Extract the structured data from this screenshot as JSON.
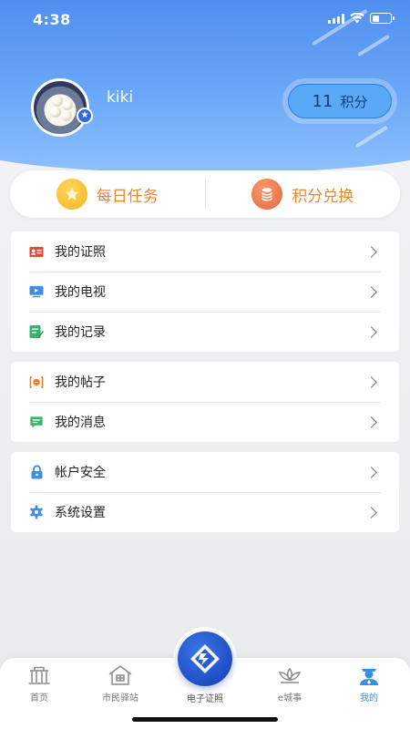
{
  "status_bar": {
    "time": "4:38"
  },
  "profile": {
    "username": "kiki",
    "points_value": "11",
    "points_unit": "积分"
  },
  "quick_actions": {
    "daily_tasks": "每日任务",
    "points_exchange": "积分兑换"
  },
  "menu": {
    "group1": [
      {
        "label": "我的证照",
        "icon": "id-card-icon"
      },
      {
        "label": "我的电视",
        "icon": "tv-icon"
      },
      {
        "label": "我的记录",
        "icon": "record-icon"
      }
    ],
    "group2": [
      {
        "label": "我的帖子",
        "icon": "post-icon"
      },
      {
        "label": "我的消息",
        "icon": "message-icon"
      }
    ],
    "group3": [
      {
        "label": "帐户安全",
        "icon": "lock-icon"
      },
      {
        "label": "系统设置",
        "icon": "gear-icon"
      }
    ]
  },
  "tabbar": {
    "home": "首页",
    "citizen_station": "市民驿站",
    "e_license": "电子证照",
    "e_city": "e城事",
    "mine": "我的"
  },
  "colors": {
    "header_blue": "#5b9bf4",
    "accent_orange": "#e6892f",
    "active_tab": "#3a8ee8"
  }
}
